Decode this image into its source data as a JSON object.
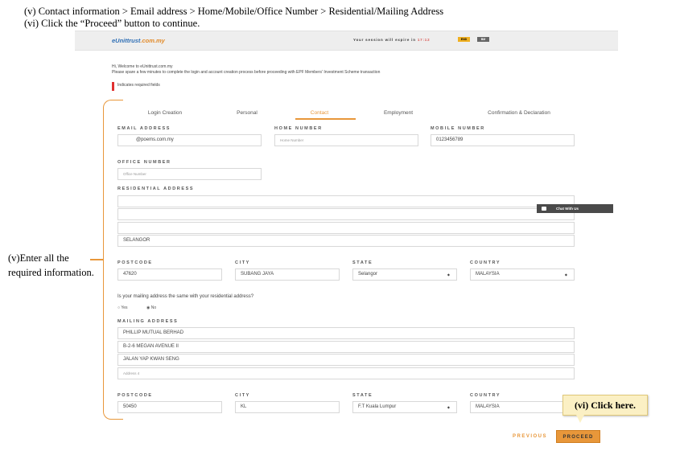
{
  "instructions": {
    "line1": "(v) Contact information > Email address > Home/Mobile/Office Number > Residential/Mailing Address",
    "line2": "(vi) Click the “Proceed” button to continue."
  },
  "header": {
    "logo_e": "e",
    "logo_brand": "Unittrust",
    "logo_domain": ".com.my",
    "session_text": "Your session will expire in",
    "session_time": "17:12",
    "extend_label": "END",
    "logout_label": "BM"
  },
  "intro": {
    "welcome": "Hi, Welcome to eUnittrust.com.my",
    "note": "Please spare a few minutes to complete the login and account creation process before proceeding with EPF Members' Investment Scheme transaction",
    "required": "Indicates required fields"
  },
  "tabs": [
    {
      "label": "Login Creation"
    },
    {
      "label": "Personal"
    },
    {
      "label": "Contact"
    },
    {
      "label": "Employment"
    },
    {
      "label": "Confirmation & Declaration"
    }
  ],
  "form": {
    "email_label": "EMAIL ADDRESS",
    "email_value": "@poems.com.my",
    "home_label": "HOME NUMBER",
    "home_placeholder": "Home Number",
    "mobile_label": "MOBILE NUMBER",
    "mobile_value": "0123456789",
    "office_label": "OFFICE NUMBER",
    "office_placeholder": "Office Number",
    "res_label": "RESIDENTIAL ADDRESS",
    "res_line1": "",
    "res_line2": "",
    "res_line3": "",
    "res_line4": "SELANGOR",
    "res_postcode_label": "POSTCODE",
    "res_postcode": "47620",
    "res_city_label": "CITY",
    "res_city": "SUBANG JAYA",
    "res_state_label": "STATE",
    "res_state": "Selangor",
    "res_country_label": "COUNTRY",
    "res_country": "MALAYSIA",
    "same_question": "Is your mailing address the same with your residential address?",
    "yes_label": "Yes",
    "no_label": "No",
    "mail_label": "MAILING ADDRESS",
    "mail_line1": "PHILLIP MUTUAL BERHAD",
    "mail_line2": "B-2-6 MEGAN AVENUE II",
    "mail_line3": "JALAN YAP KWAN SENG",
    "mail_line4_placeholder": "Address 4",
    "mail_postcode_label": "POSTCODE",
    "mail_postcode": "50450",
    "mail_city_label": "CITY",
    "mail_city": "KL",
    "mail_state_label": "STATE",
    "mail_state": "F.T Kuala Lumpur",
    "mail_country_label": "COUNTRY",
    "mail_country": "MALAYSIA"
  },
  "chat": {
    "label": "Chat With Us"
  },
  "annotations": {
    "left": "(v)Enter all the required information.",
    "click": "(vi) Click here."
  },
  "footer": {
    "previous": "PREVIOUS",
    "proceed": "PROCEED"
  },
  "colors": {
    "accent": "#e8973a",
    "required": "#e03030"
  }
}
